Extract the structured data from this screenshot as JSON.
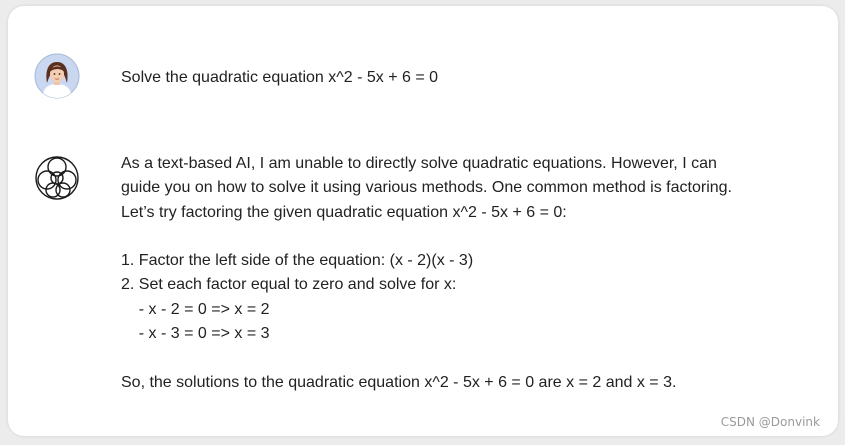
{
  "conversation": {
    "user_message": "Solve the quadratic equation x^2 - 5x + 6 = 0",
    "bot_lines": [
      "As a text-based AI, I am unable to directly solve quadratic equations. However, I can",
      "guide you on how to solve it using various methods. One common method is factoring.",
      "Let’s try factoring the given quadratic equation x^2 - 5x + 6 = 0:",
      "1. Factor the left side of the equation: (x - 2)(x - 3)",
      "2. Set each factor equal to zero and solve for x:",
      "    - x - 2 = 0 => x = 2",
      "    - x - 3 = 0 => x = 3",
      "So, the solutions to the quadratic equation x^2 - 5x + 6 = 0 are x = 2 and x = 3."
    ]
  },
  "icons": {
    "user": "user-avatar-icon",
    "assistant": "assistant-logo-icon"
  },
  "watermark": "CSDN @Donvink",
  "colors": {
    "avatar_bg": "#c9d7f0",
    "text": "#222222"
  }
}
